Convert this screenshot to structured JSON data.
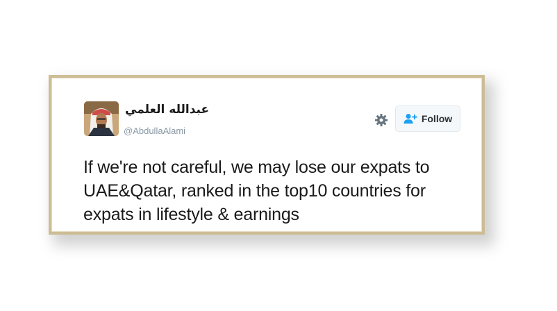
{
  "tweet": {
    "display_name": "عبدالله العلمي",
    "handle": "@AbdullaAlami",
    "follow_label": "Follow",
    "text_lines": [
      "If we're not careful, we may lose our expats to",
      "UAE&Qatar, ranked in the top10 countries for",
      "expats in lifestyle & earnings"
    ]
  },
  "icons": {
    "settings": "gear-icon",
    "follow": "add-user-icon"
  },
  "colors": {
    "frame_border": "#cdbd95",
    "handle_text": "#8899a6",
    "follow_icon": "#1da1f2",
    "gear": "#66757f"
  }
}
